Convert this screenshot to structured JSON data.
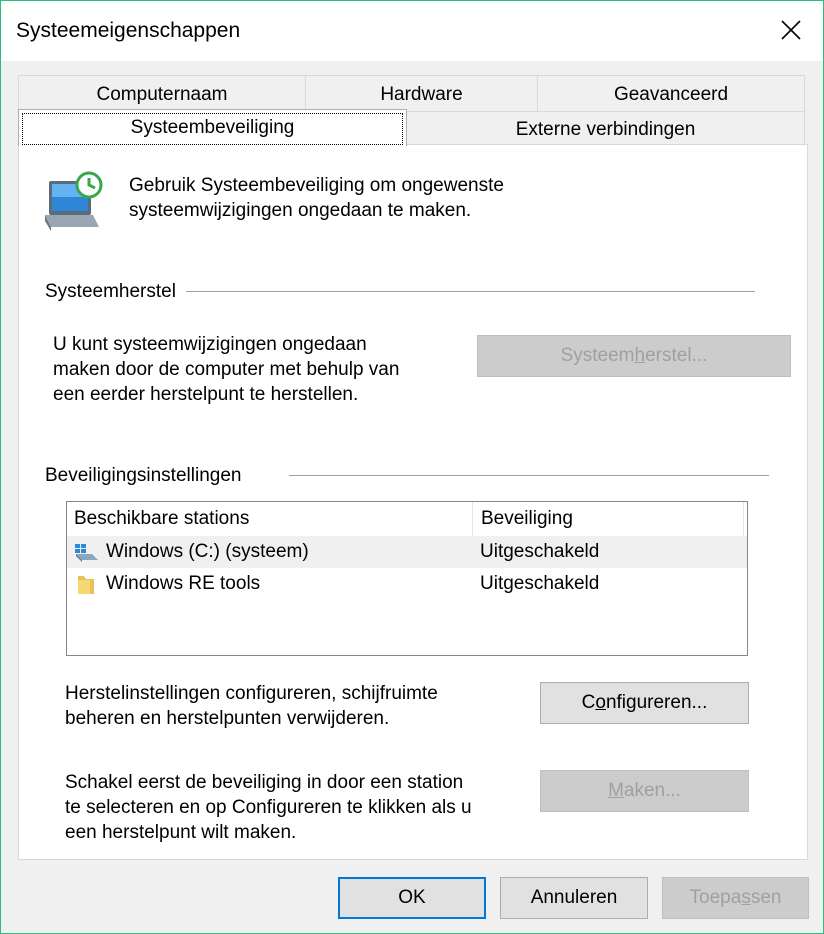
{
  "window": {
    "title": "Systeemeigenschappen",
    "close_icon": "close-icon"
  },
  "tabs": {
    "row1": [
      "Computernaam",
      "Hardware",
      "Geavanceerd"
    ],
    "row2": [
      "Systeembeveiliging",
      "Externe verbindingen"
    ],
    "selected": "Systeembeveiliging"
  },
  "intro": {
    "icon": "system-protection-icon",
    "text_line1": "Gebruik Systeembeveiliging om ongewenste",
    "text_line2": "systeemwijzigingen ongedaan te maken."
  },
  "restore": {
    "group_title": "Systeemherstel",
    "desc_line1": "U kunt systeemwijzigingen ongedaan",
    "desc_line2": "maken door de computer met behulp van",
    "desc_line3": "een eerder herstelpunt te herstellen.",
    "button_pre": "Systeem",
    "button_access": "h",
    "button_post": "erstel...",
    "button_state": "disabled"
  },
  "protection": {
    "group_title": "Beveiligingsinstellingen",
    "columns": [
      "Beschikbare stations",
      "Beveiliging"
    ],
    "rows": [
      {
        "name": "Windows (C:) (systeem)",
        "status": "Uitgeschakeld",
        "icon": "drive-icon"
      },
      {
        "name": "Windows RE tools",
        "status": "Uitgeschakeld",
        "icon": "folder-icon"
      }
    ],
    "configure_line1": "Herstelinstellingen configureren, schijfruimte",
    "configure_line2": "beheren en herstelpunten verwijderen.",
    "configure_pre": "C",
    "configure_access": "o",
    "configure_post": "nfigureren...",
    "create_line1": "Schakel eerst de beveiliging in door een station",
    "create_line2": "te selecteren en op Configureren te klikken als u",
    "create_line3": "een herstelpunt wilt maken.",
    "create_access": "M",
    "create_post": "aken...",
    "create_state": "disabled"
  },
  "footer": {
    "ok": "OK",
    "cancel": "Annuleren",
    "apply_pre": "Toepa",
    "apply_access": "s",
    "apply_post": "sen",
    "apply_state": "disabled"
  },
  "colors": {
    "window_border": "#29c07a",
    "accent": "#0078d7",
    "disabled_text": "#a0a0a0"
  }
}
